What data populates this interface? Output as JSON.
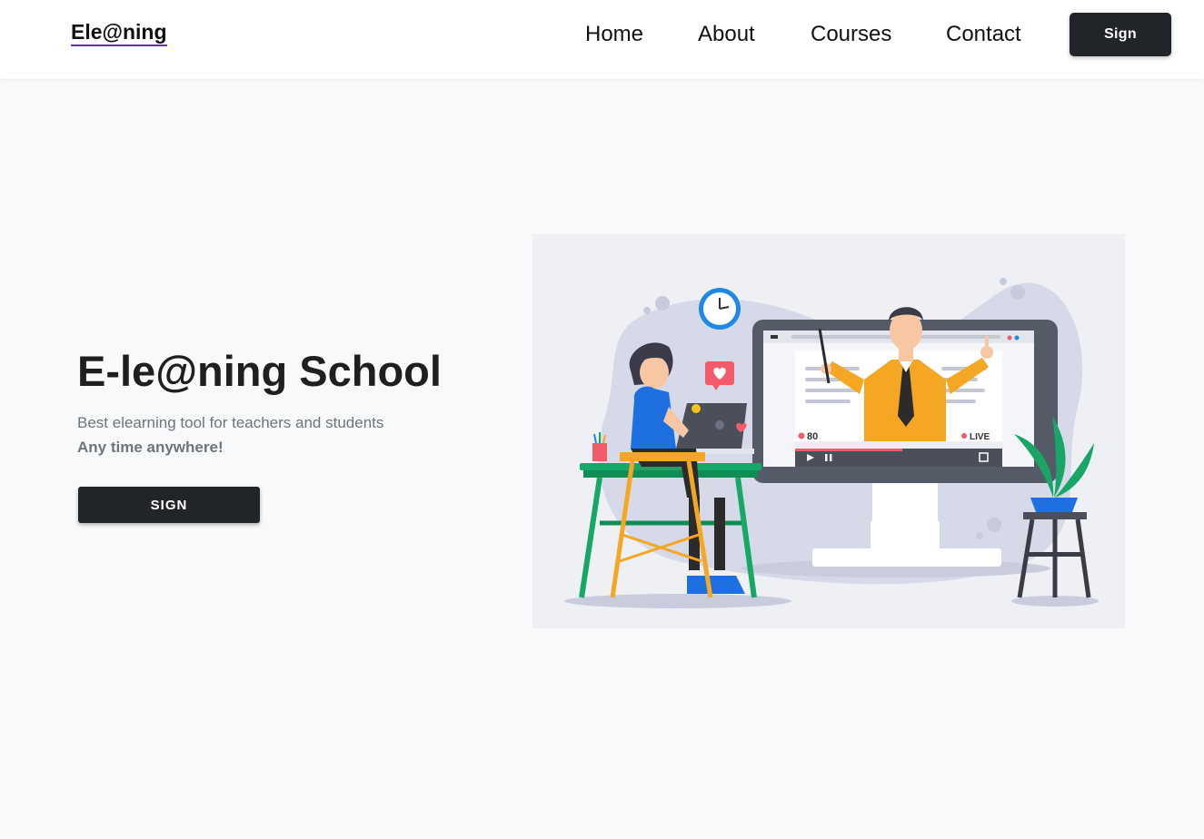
{
  "navbar": {
    "brand": "Ele@ning",
    "links": [
      "Home",
      "About",
      "Courses",
      "Contact"
    ],
    "sign_label": "Sign"
  },
  "hero": {
    "title": "E-le@ning School",
    "subtitle": "Best elearning tool for teachers and students",
    "tagline": "Any time anywhere!",
    "button_label": "SIGN"
  },
  "illustration": {
    "viewer_count": "80",
    "live_label": "LIVE"
  },
  "colors": {
    "primary_dark": "#212529",
    "brand_underline": "#6f2da8",
    "background": "#f8f9fa"
  }
}
